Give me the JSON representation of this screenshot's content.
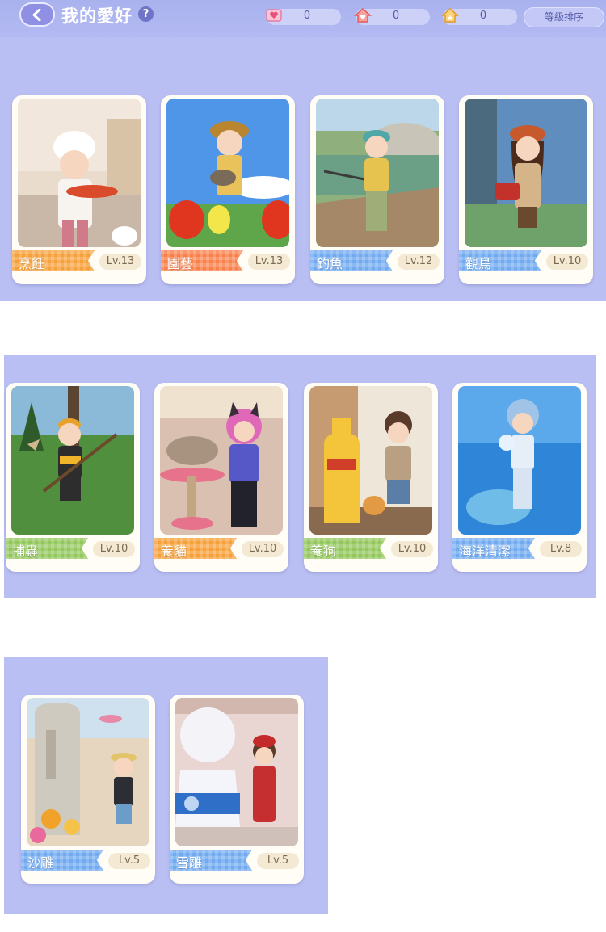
{
  "header": {
    "title": "我的愛好",
    "help_icon": "?",
    "sort_label": "等級排序"
  },
  "currencies": [
    {
      "icon": "heart-ticket-icon",
      "value": "0",
      "color": "#f08bb0"
    },
    {
      "icon": "heart-house-icon",
      "value": "0",
      "color": "#f07a7a"
    },
    {
      "icon": "star-house-icon",
      "value": "0",
      "color": "#f5b23a"
    }
  ],
  "hobbies": [
    {
      "name": "烹飪",
      "level": "Lv.13",
      "ribbon_color": "#f6a03a"
    },
    {
      "name": "園藝",
      "level": "Lv.13",
      "ribbon_color": "#f8804a"
    },
    {
      "name": "釣魚",
      "level": "Lv.12",
      "ribbon_color": "#72aaf0"
    },
    {
      "name": "觀鳥",
      "level": "Lv.10",
      "ribbon_color": "#72aaf0"
    },
    {
      "name": "捕蟲",
      "level": "Lv.10",
      "ribbon_color": "#92c75c"
    },
    {
      "name": "養貓",
      "level": "Lv.10",
      "ribbon_color": "#f6a03a"
    },
    {
      "name": "養狗",
      "level": "Lv.10",
      "ribbon_color": "#92c75c"
    },
    {
      "name": "海洋清潔",
      "level": "Lv.8",
      "ribbon_color": "#72aaf0"
    },
    {
      "name": "沙雕",
      "level": "Lv.5",
      "ribbon_color": "#72aaf0"
    },
    {
      "name": "雪雕",
      "level": "Lv.5",
      "ribbon_color": "#72aaf0"
    }
  ]
}
